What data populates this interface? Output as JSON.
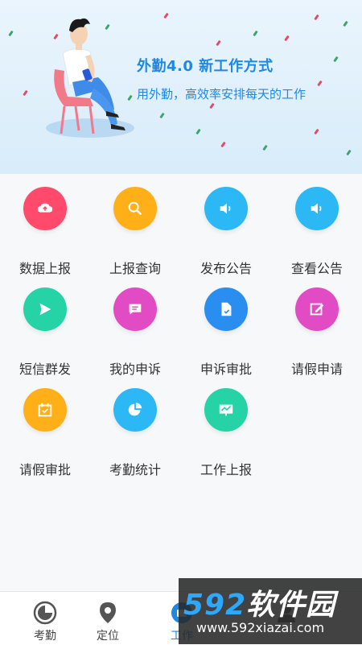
{
  "banner": {
    "title": "外勤4.0  新工作方式",
    "subtitle": "用外勤，高效率安排每天的工作"
  },
  "grid": {
    "items": [
      {
        "label": "数据上报",
        "icon": "cloud-upload-icon",
        "color": "#ff4a6b"
      },
      {
        "label": "上报查询",
        "icon": "search-icon",
        "color": "#ffb018"
      },
      {
        "label": "发布公告",
        "icon": "speaker-icon",
        "color": "#2cb8f5"
      },
      {
        "label": "查看公告",
        "icon": "speaker-icon",
        "color": "#2cb8f5"
      },
      {
        "label": "短信群发",
        "icon": "send-icon",
        "color": "#26d3a6"
      },
      {
        "label": "我的申诉",
        "icon": "message-icon",
        "color": "#e14bc4"
      },
      {
        "label": "申诉审批",
        "icon": "document-check-icon",
        "color": "#2a8ef0"
      },
      {
        "label": "请假申请",
        "icon": "edit-icon",
        "color": "#e14bc4"
      },
      {
        "label": "请假审批",
        "icon": "calendar-check-icon",
        "color": "#ffb018"
      },
      {
        "label": "考勤统计",
        "icon": "pie-chart-icon",
        "color": "#2cb8f5"
      },
      {
        "label": "工作上报",
        "icon": "presentation-chart-icon",
        "color": "#26d3a6"
      }
    ]
  },
  "bottom_nav": {
    "items": [
      {
        "label": "考勤",
        "icon": "clock-icon"
      },
      {
        "label": "定位",
        "icon": "location-pin-icon"
      },
      {
        "label": "工作",
        "icon": "work-icon",
        "active": true
      },
      {
        "label": "",
        "icon": "profile-icon"
      }
    ]
  },
  "watermark": {
    "brand_num": "592",
    "brand_text": "软件园",
    "url": "www.592xiazai.com"
  }
}
